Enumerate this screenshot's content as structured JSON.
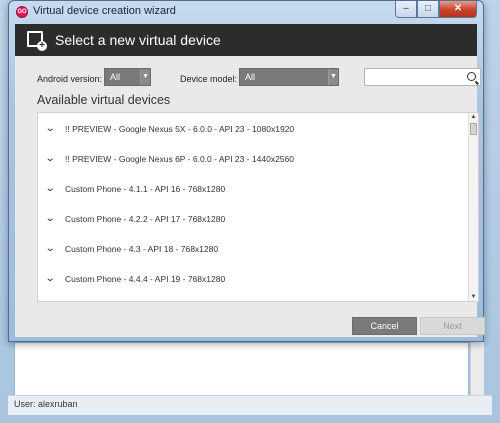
{
  "window": {
    "title": "Virtual device creation wizard",
    "icon_text": "GO",
    "controls": {
      "minimize": "–",
      "maximize": "□",
      "close": "✕"
    }
  },
  "header": {
    "title": "Select a new virtual device"
  },
  "filters": {
    "android_version_label": "Android version:",
    "android_version_value": "All",
    "device_model_label": "Device model:",
    "device_model_value": "All",
    "search_placeholder": ""
  },
  "list": {
    "title": "Available virtual devices",
    "devices": [
      "!! PREVIEW - Google Nexus 5X - 6.0.0 - API 23 - 1080x1920",
      "!! PREVIEW - Google Nexus 6P - 6.0.0 - API 23 - 1440x2560",
      "Custom Phone - 4.1.1 - API 16 - 768x1280",
      "Custom Phone - 4.2.2 - API 17 - 768x1280",
      "Custom Phone - 4.3 - API 18 - 768x1280",
      "Custom Phone - 4.4.4 - API 19 - 768x1280"
    ]
  },
  "buttons": {
    "cancel": "Cancel",
    "next": "Next"
  },
  "status_bar": {
    "text": "User: alexruban"
  },
  "icons": {
    "app": "genymotion-logo-icon",
    "header": "new-device-icon",
    "chevron": "chevron-down-icon",
    "search": "search-icon"
  }
}
